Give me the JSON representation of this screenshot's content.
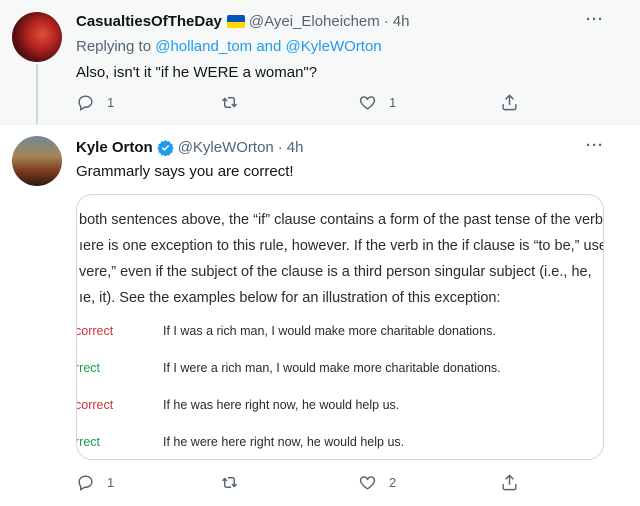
{
  "tweet1": {
    "display_name": "CasualtiesOfTheDay",
    "handle": "@Ayei_Eloheichem",
    "time": "4h",
    "replying_prefix": "Replying to",
    "replying_user1": "@holland_tom",
    "replying_and": "and",
    "replying_user2": "@KyleWOrton",
    "text": "Also, isn't it \"if he WERE a woman\"?",
    "reply_count": "1",
    "retweet_count": "",
    "like_count": "1"
  },
  "tweet2": {
    "display_name": "Kyle Orton",
    "handle": "@KyleWOrton",
    "time": "4h",
    "text": "Grammarly says you are correct!",
    "reply_count": "1",
    "retweet_count": "",
    "like_count": "2",
    "card": {
      "lines": [
        " both sentences above, the “if” clause contains a form of the past tense of the verb.",
        "ıere is one exception to this rule, however. If the verb in the if clause is “to be,” use",
        "vere,” even if the subject of the clause is a third person singular subject (i.e., he,",
        "ıe, it). See the examples below for an illustration of this exception:"
      ],
      "examples": [
        {
          "label": "correct",
          "status": "incorrect",
          "sentence": "If I was a rich man, I would make more charitable donations."
        },
        {
          "label": "rrect",
          "status": "correct",
          "sentence": "If I were a rich man, I would make more charitable donations."
        },
        {
          "label": "correct",
          "status": "incorrect",
          "sentence": "If he was here right now, he would help us."
        },
        {
          "label": "rrect",
          "status": "correct",
          "sentence": "If he were here right now, he would help us."
        }
      ]
    }
  },
  "icons": {
    "more": "more-icon",
    "reply": "reply-icon",
    "retweet": "retweet-icon",
    "like": "heart-icon",
    "share": "share-icon",
    "verified": "verified-badge-icon",
    "flag": "ukraine-flag-icon"
  },
  "colors": {
    "link": "#1d9bf0",
    "muted": "#536471",
    "incorrect": "#d0343a",
    "correct": "#16a34a",
    "reply_bg": "#f7f9f9"
  }
}
